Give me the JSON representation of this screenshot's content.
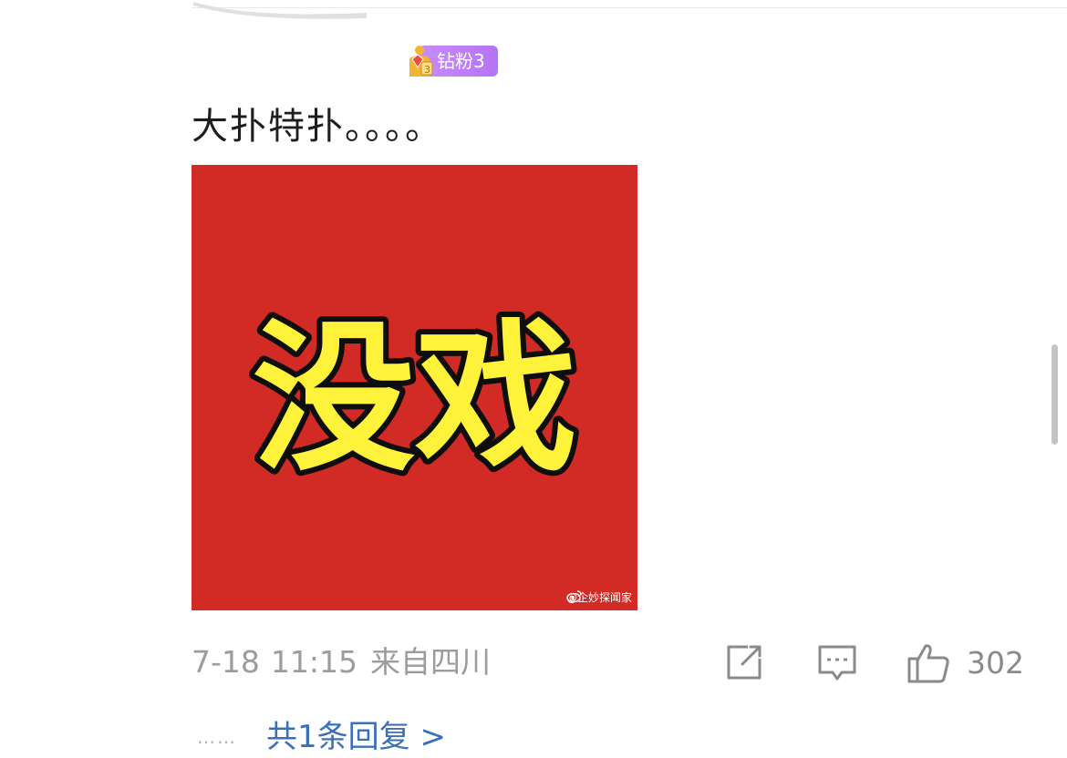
{
  "badge": {
    "label": "钻粉3",
    "crest_icon": "diamond-fan-crest-icon",
    "colors": {
      "pill": "#c285fb",
      "crest_gold": "#f3b531",
      "gem": "#ef4a3b"
    }
  },
  "comment": {
    "text": "大扑特扑。。。。",
    "image": {
      "caption_text": "没戏",
      "watermark": "@企妙探闻家",
      "watermark_icon": "weibo-icon",
      "colors": {
        "background": "#d22b25",
        "text": "#fff23a",
        "outline": "#0e0e0e"
      }
    }
  },
  "meta": {
    "date": "7-18",
    "time": "11:15",
    "location": "来自四川"
  },
  "actions": {
    "share_icon": "share-icon",
    "reply_icon": "comment-icon",
    "like_icon": "thumbs-up-icon",
    "like_count": "302"
  },
  "replies": {
    "dots": "……",
    "link": "共1条回复 >"
  },
  "colors": {
    "meta_text": "#9c9c9c",
    "link": "#3d6fb8",
    "icon": "#8a8a8a"
  }
}
